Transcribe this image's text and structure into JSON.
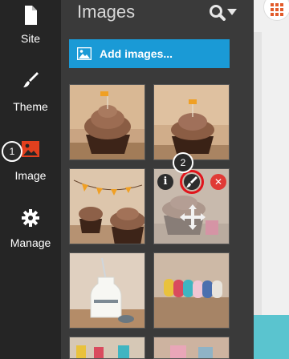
{
  "rail": {
    "items": [
      {
        "label": "Site",
        "icon": "document-icon"
      },
      {
        "label": "Theme",
        "icon": "brush-icon"
      },
      {
        "label": "Image",
        "icon": "image-icon",
        "active": true
      },
      {
        "label": "Manage",
        "icon": "gear-icon"
      }
    ],
    "step_badge": "1"
  },
  "panel": {
    "title": "Images",
    "add_button": "Add images...",
    "step_badge": "2",
    "thumbnails": [
      {
        "subject": "cupcake with flag"
      },
      {
        "subject": "cupcake with flag"
      },
      {
        "subject": "cupcakes with bunting"
      },
      {
        "subject": "cupcake",
        "hover_tools": [
          "info-icon",
          "edit-brush-icon",
          "delete-icon",
          "move-icon"
        ]
      },
      {
        "subject": "milk bottle"
      },
      {
        "subject": "tape rolls"
      }
    ]
  },
  "colors": {
    "rail_bg": "#252525",
    "panel_bg": "#3a3a3a",
    "accent_blue": "#1a9ad6",
    "active_red": "#e2401e",
    "highlight_ring": "#e0141b",
    "teal": "#5ac4cf"
  }
}
